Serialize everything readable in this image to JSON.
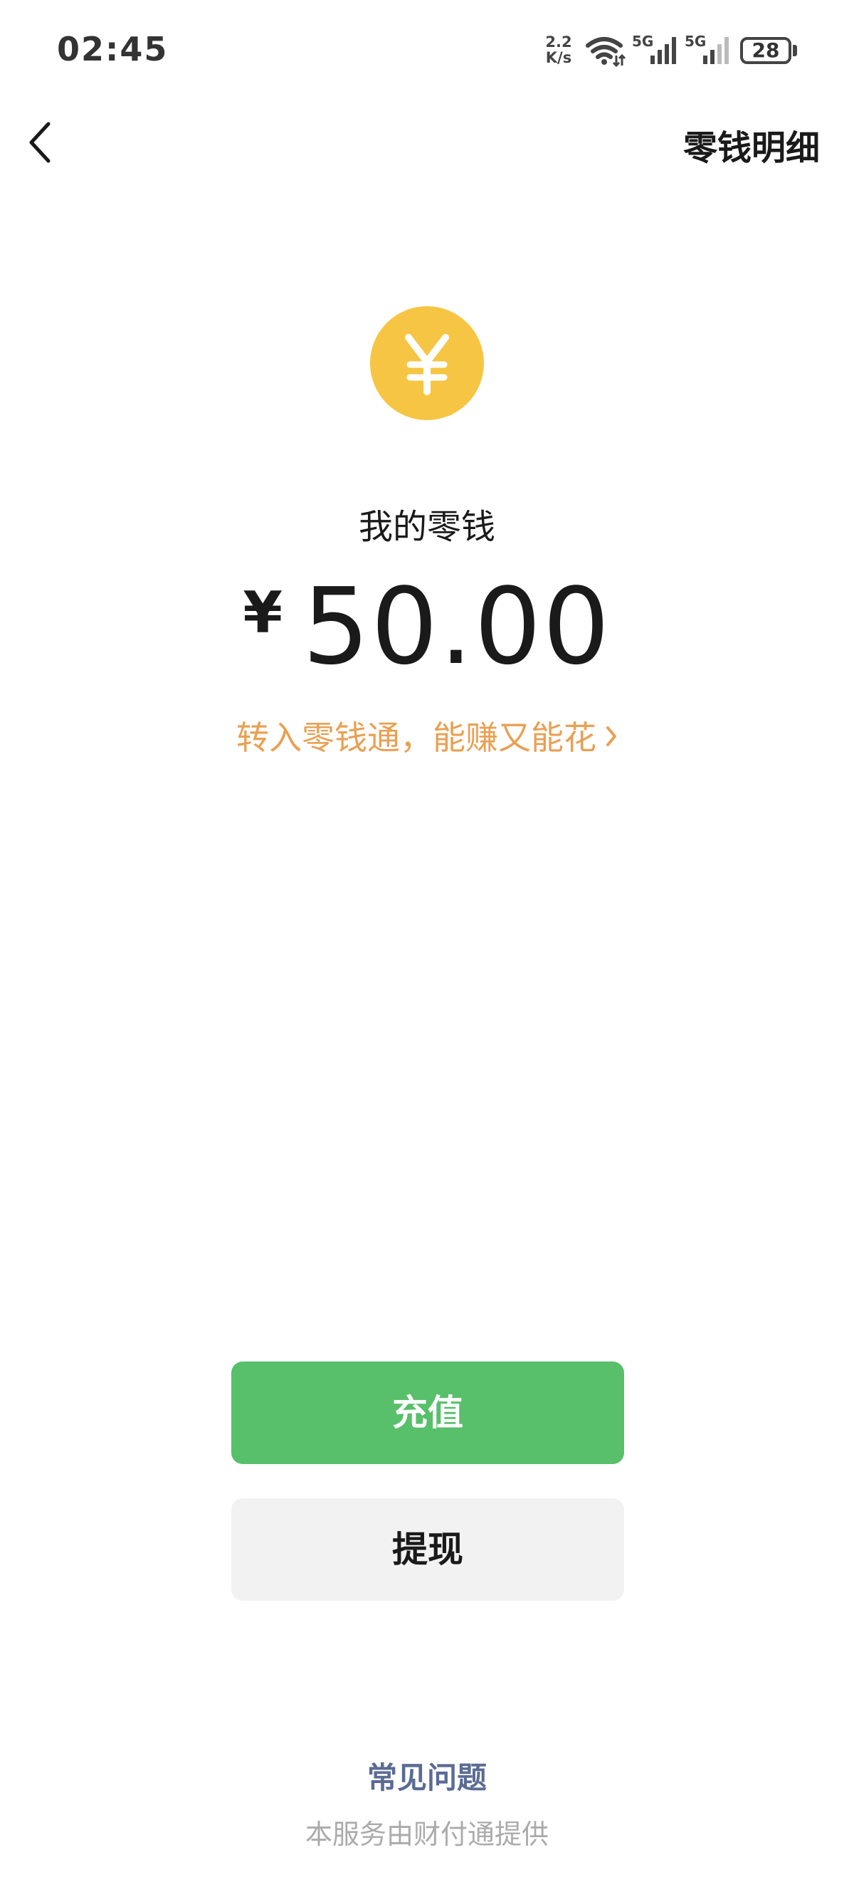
{
  "status_bar": {
    "time": "02:45",
    "net_speed_value": "2.2",
    "net_speed_unit": "K/s",
    "signal_1_label": "5G",
    "signal_2_label": "5G",
    "battery_level": "28",
    "icons": [
      "wifi-icon",
      "signal-icon",
      "signal-icon",
      "battery-icon"
    ]
  },
  "nav": {
    "back_icon": "chevron-left-icon",
    "title_right": "零钱明细"
  },
  "wallet": {
    "coin_icon": "yuan-coin-icon",
    "coin_color": "#f6c543",
    "label": "我的零钱",
    "currency_symbol": "¥",
    "amount": "50.00",
    "promo_text": "转入零钱通，能赚又能花",
    "promo_color": "#e9a053"
  },
  "actions": {
    "recharge_label": "充值",
    "recharge_color": "#58bf6b",
    "withdraw_label": "提现"
  },
  "footer": {
    "faq_label": "常见问题",
    "provider_note": "本服务由财付通提供"
  }
}
